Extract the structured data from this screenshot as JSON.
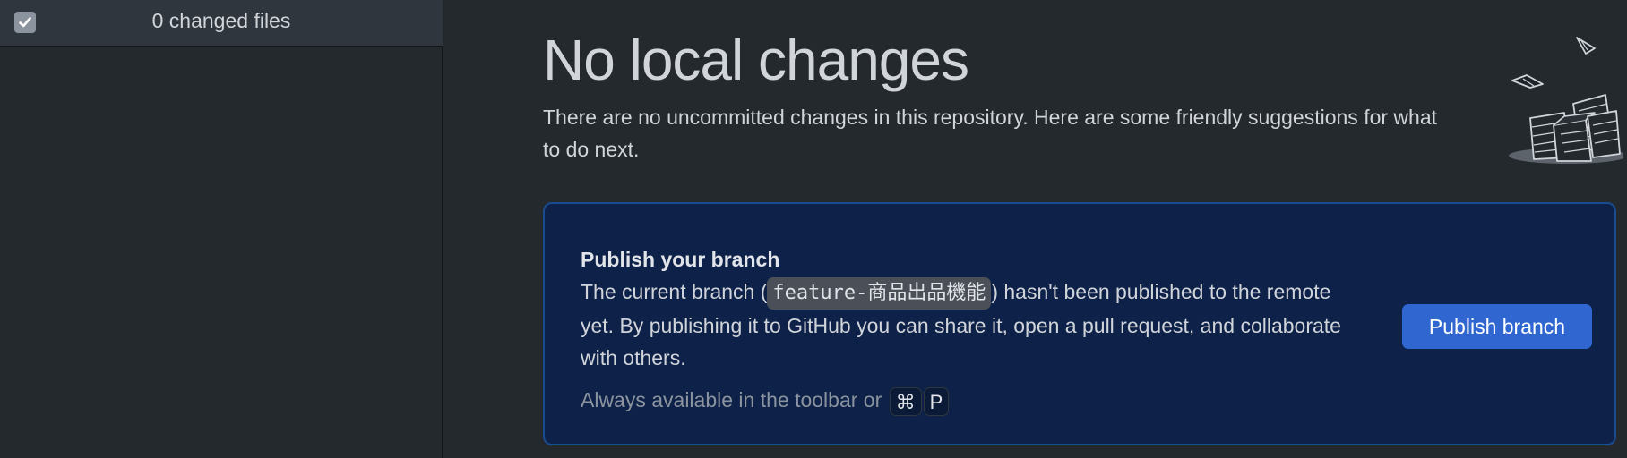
{
  "sidebar": {
    "changed_files_label": "0 changed files",
    "select_all_checked": true
  },
  "main": {
    "title": "No local changes",
    "subtitle": "There are no uncommitted changes in this repository. Here are some friendly suggestions for what to do next.",
    "suggestion": {
      "title": "Publish your branch",
      "desc_before": "The current branch (",
      "branch_name": "feature-商品出品機能",
      "desc_after": ") hasn't been published to the remote yet. By publishing it to GitHub you can share it, open a pull request, and collaborate with others.",
      "hint_text": "Always available in the toolbar or",
      "shortcut_keys": [
        "⌘",
        "P"
      ],
      "button_label": "Publish branch"
    }
  },
  "icons": {
    "checkbox": "checkmark-icon",
    "illustration": "empty-papers-illustration-icon"
  },
  "colors": {
    "background": "#24292e",
    "card_background": "#0d2149",
    "card_border": "#1b4b8f",
    "button": "#2f66d0"
  }
}
